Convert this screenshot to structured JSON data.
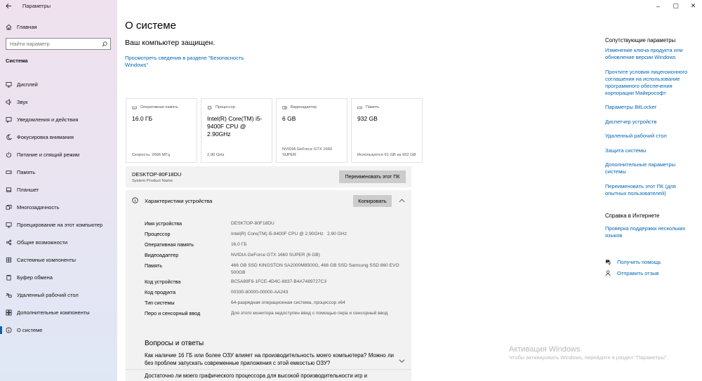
{
  "window": {
    "title": "Параметры",
    "controls": [
      "–",
      "▢",
      "✕"
    ]
  },
  "sidebar": {
    "home_label": "Главная",
    "search_placeholder": "Найти параметр",
    "section_title": "Система",
    "items": [
      {
        "label": "Дисплей",
        "icon": "display-icon"
      },
      {
        "label": "Звук",
        "icon": "speaker-icon"
      },
      {
        "label": "Уведомления и действия",
        "icon": "notification-icon"
      },
      {
        "label": "Фокусировка внимания",
        "icon": "moon-icon"
      },
      {
        "label": "Питание и спящий режим",
        "icon": "power-icon"
      },
      {
        "label": "Память",
        "icon": "storage-icon"
      },
      {
        "label": "Планшет",
        "icon": "tablet-icon"
      },
      {
        "label": "Многозадачность",
        "icon": "multitask-icon"
      },
      {
        "label": "Проецирование на этот компьютер",
        "icon": "project-icon"
      },
      {
        "label": "Общие возможности",
        "icon": "shared-icon"
      },
      {
        "label": "Системные компоненты",
        "icon": "components-icon"
      },
      {
        "label": "Буфер обмена",
        "icon": "clipboard-icon"
      },
      {
        "label": "Удаленный рабочий стол",
        "icon": "remote-icon"
      },
      {
        "label": "Дополнительные компоненты",
        "icon": "addons-icon"
      },
      {
        "label": "О системе",
        "icon": "info-icon",
        "active": true
      }
    ]
  },
  "main": {
    "title": "О системе",
    "protected_text": "Ваш компьютер защищен.",
    "security_link": "Просмотреть сведения в разделе \"Безопасность Windows\"",
    "cards": [
      {
        "head": "Оперативная память",
        "value": "16.0 ГБ",
        "foot": "Скорость: 2666 МГц",
        "icon": "ram-icon"
      },
      {
        "head": "Процессор",
        "value": "Intel(R) Core(TM) i5-9400F CPU @ 2.90GHz",
        "foot": "2.90 GHz",
        "icon": "cpu-icon"
      },
      {
        "head": "Видеоадаптер",
        "value": "6 GB",
        "foot": "NVIDIA GeForce GTX 1660 SUPER",
        "icon": "gpu-icon"
      },
      {
        "head": "Память",
        "value": "932 GB",
        "foot": "Используется 91 GB из 932 GB",
        "icon": "disk-icon"
      }
    ],
    "device": {
      "name": "DESKTOP-80F18DU",
      "sub": "System Product Name",
      "rename_label": "Переименовать этот ПК"
    },
    "specs": {
      "title": "Характеристики устройства",
      "copy_label": "Копировать",
      "rows": [
        {
          "label": "Имя устройства",
          "value": "DESKTOP-80F18DU"
        },
        {
          "label": "Процессор",
          "value": "Intel(R) Core(TM) i5-9400F CPU @ 2.90GHz   2.90 GHz"
        },
        {
          "label": "Оперативная память",
          "value": "16.0 ГБ"
        },
        {
          "label": "Видеоадаптер",
          "value": "NVIDIA GeForce GTX 1660 SUPER (6 GB)"
        },
        {
          "label": "Память",
          "value": "466 GB SSD KINGSTON SA2000M8500G, 466 GB SSD Samsung SSD 860 EVO 500GB"
        },
        {
          "label": "Код устройства",
          "value": "BC5A89F8-1FCE-4D4C-8837-B4A7489727C3"
        },
        {
          "label": "Код продукта",
          "value": "00330-80000-00000-AA243"
        },
        {
          "label": "Тип системы",
          "value": "64-разрядная операционная система, процессор x64"
        },
        {
          "label": "Перо и сенсорный ввод",
          "value": "Для этого монитора недоступен ввод с помощью пера и сенсорный ввод"
        }
      ]
    },
    "faq": {
      "title": "Вопросы и ответы",
      "q1": "Как наличие 16 ГБ или более ОЗУ влияет на производительность моего компьютера? Можно ли без проблем запускать современные приложения с этой емкостью ОЗУ?",
      "q2": "Достаточно ли моего графического процессора для высокой производительности игр и"
    }
  },
  "right": {
    "related_title": "Сопутствующие параметры",
    "related_links": [
      "Изменение ключа продукта или обновление версии Windows",
      "Прочтите условия лицензионного соглашения на использование программного обеспечения корпорации Майкрософт",
      "Параметры BitLocker",
      "Диспетчер устройств",
      "Удаленный рабочий стол",
      "Защита системы",
      "Дополнительные параметры системы",
      "Переименовать этот ПК (для опытных пользователей)"
    ],
    "help_title": "Справка в Интернете",
    "help_link": "Проверка поддержки нескольких языков",
    "get_help": "Получить помощь",
    "feedback": "Отправить отзыв"
  },
  "watermark": {
    "line1": "Активация Windows",
    "line2": "Чтобы активировать Windows, перейдите в раздел \"Параметры\"."
  },
  "colors": {
    "accent": "#0063b1",
    "link": "#0066b4"
  }
}
